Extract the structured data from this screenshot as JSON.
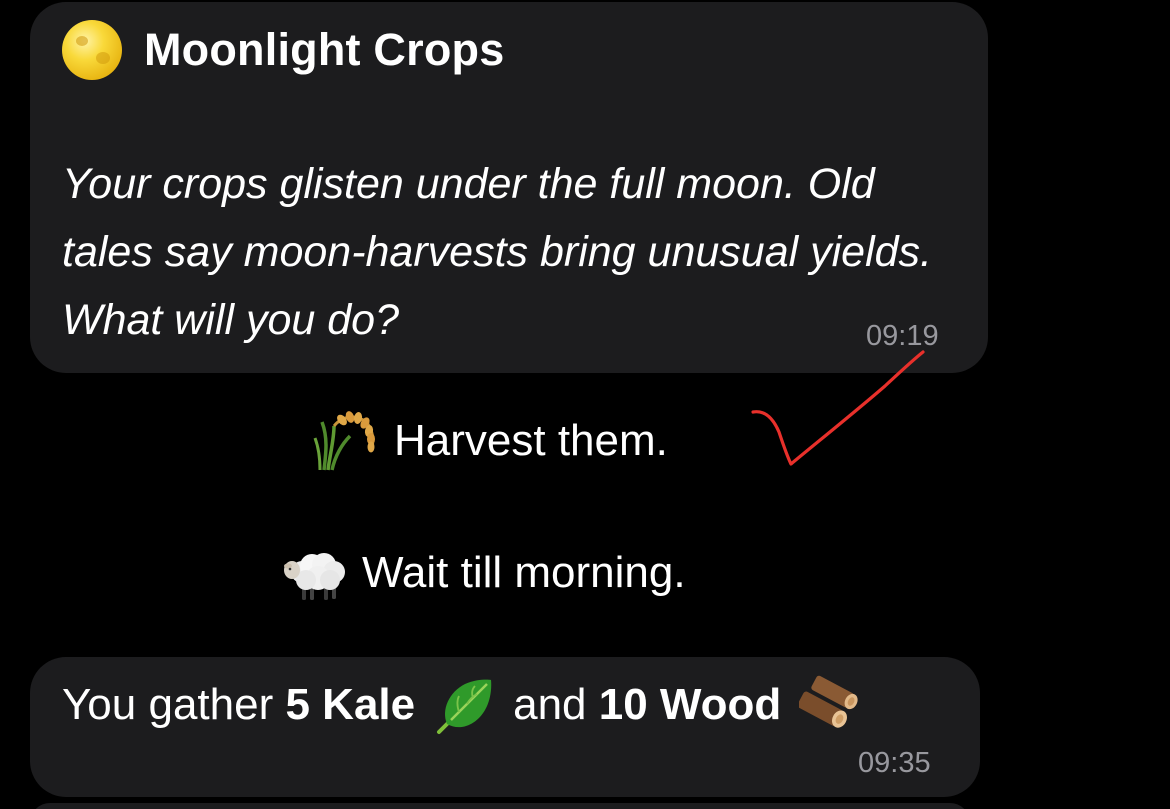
{
  "event": {
    "icon": "full-moon-icon",
    "title": "Moonlight Crops",
    "body": "Your crops glisten under the full moon. Old tales say moon-harvests bring unusual yields. What will you do?",
    "time": "09:19"
  },
  "options": [
    {
      "icon": "rice-sheaf-icon",
      "label": "Harvest them.",
      "selected": true
    },
    {
      "icon": "sheep-icon",
      "label": "Wait till morning.",
      "selected": false
    }
  ],
  "annotation": {
    "icon": "checkmark-icon",
    "color": "#e8302b"
  },
  "result": {
    "prefix": "You gather",
    "item1": "5 Kale",
    "item1_icon": "leafy-green-icon",
    "joiner": "and",
    "item2": "10 Wood",
    "item2_icon": "wood-logs-icon",
    "time": "09:35"
  },
  "colors": {
    "background": "#000000",
    "bubble": "#1c1c1e",
    "text": "#ffffff",
    "timestamp": "#98989e"
  }
}
